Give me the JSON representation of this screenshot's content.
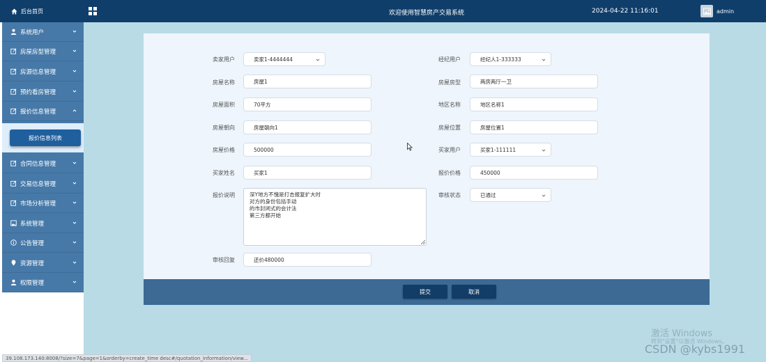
{
  "topbar": {
    "home_label": "后台首页",
    "title": "欢迎使用智慧房产交易系统",
    "datetime": "2024-04-22 11:16:01",
    "user": "admin"
  },
  "sidebar": {
    "items": [
      {
        "label": "系统用户",
        "icon": "user-icon",
        "expanded": false
      },
      {
        "label": "房屋房型管理",
        "icon": "edit-icon",
        "expanded": false
      },
      {
        "label": "房源信息管理",
        "icon": "edit-icon",
        "expanded": false
      },
      {
        "label": "预约看房管理",
        "icon": "edit-icon",
        "expanded": false
      },
      {
        "label": "报价信息管理",
        "icon": "edit-icon",
        "expanded": true
      },
      {
        "label": "合同信息管理",
        "icon": "edit-icon",
        "expanded": false
      },
      {
        "label": "交易信息管理",
        "icon": "edit-icon",
        "expanded": false
      },
      {
        "label": "市场分析管理",
        "icon": "edit-icon",
        "expanded": false
      },
      {
        "label": "系统管理",
        "icon": "image-icon",
        "expanded": false
      },
      {
        "label": "公告管理",
        "icon": "info-icon",
        "expanded": false
      },
      {
        "label": "资源管理",
        "icon": "pin-icon",
        "expanded": false
      },
      {
        "label": "权限管理",
        "icon": "user-icon",
        "expanded": false
      }
    ],
    "sub_item": "报价信息列表"
  },
  "form": {
    "seller_user": {
      "label": "卖家用户",
      "value": "卖家1-4444444"
    },
    "agent_user": {
      "label": "经纪用户",
      "value": "经纪人1-333333"
    },
    "house_name": {
      "label": "房屋名称",
      "value": "房屋1"
    },
    "house_type": {
      "label": "房屋房型",
      "value": "两房两厅一卫"
    },
    "house_area": {
      "label": "房屋面积",
      "value": "70平方"
    },
    "region_name": {
      "label": "地区名称",
      "value": "地区名称1"
    },
    "orientation": {
      "label": "房屋朝向",
      "value": "房屋朝向1"
    },
    "location": {
      "label": "房屋位置",
      "value": "房屋位置1"
    },
    "house_price": {
      "label": "房屋价格",
      "value": "500000"
    },
    "buyer_user": {
      "label": "买家用户",
      "value": "买家1-111111"
    },
    "buyer_name": {
      "label": "买家姓名",
      "value": "买家1"
    },
    "offer_price": {
      "label": "报价价格",
      "value": "450000"
    },
    "offer_desc": {
      "label": "报价说明",
      "value": "深Y地方不愧是打击报复扩大时\n对方的身份包括手动\n的市封闭式的会计法\n第三方都开始"
    },
    "review_status": {
      "label": "审核状态",
      "value": "已通过"
    },
    "review_reply": {
      "label": "审核回复",
      "value": "还价480000"
    }
  },
  "actions": {
    "submit": "提交",
    "cancel": "取消"
  },
  "status_url": "39.108.173.140:8008/?size=7&page=1&orderby=create_time desc#/quotation_information/view...",
  "watermark": {
    "activate": "激活 Windows",
    "activate_hint": "转到\"设置\"以激活 Windows。",
    "csdn": "CSDN @kybs1991"
  },
  "colors": {
    "topbar": "#0f3e6b",
    "sidebar": "#4679a8",
    "active_sub": "#1f5f9e",
    "button": "#123d66",
    "page_bg": "#b8dbe6"
  }
}
